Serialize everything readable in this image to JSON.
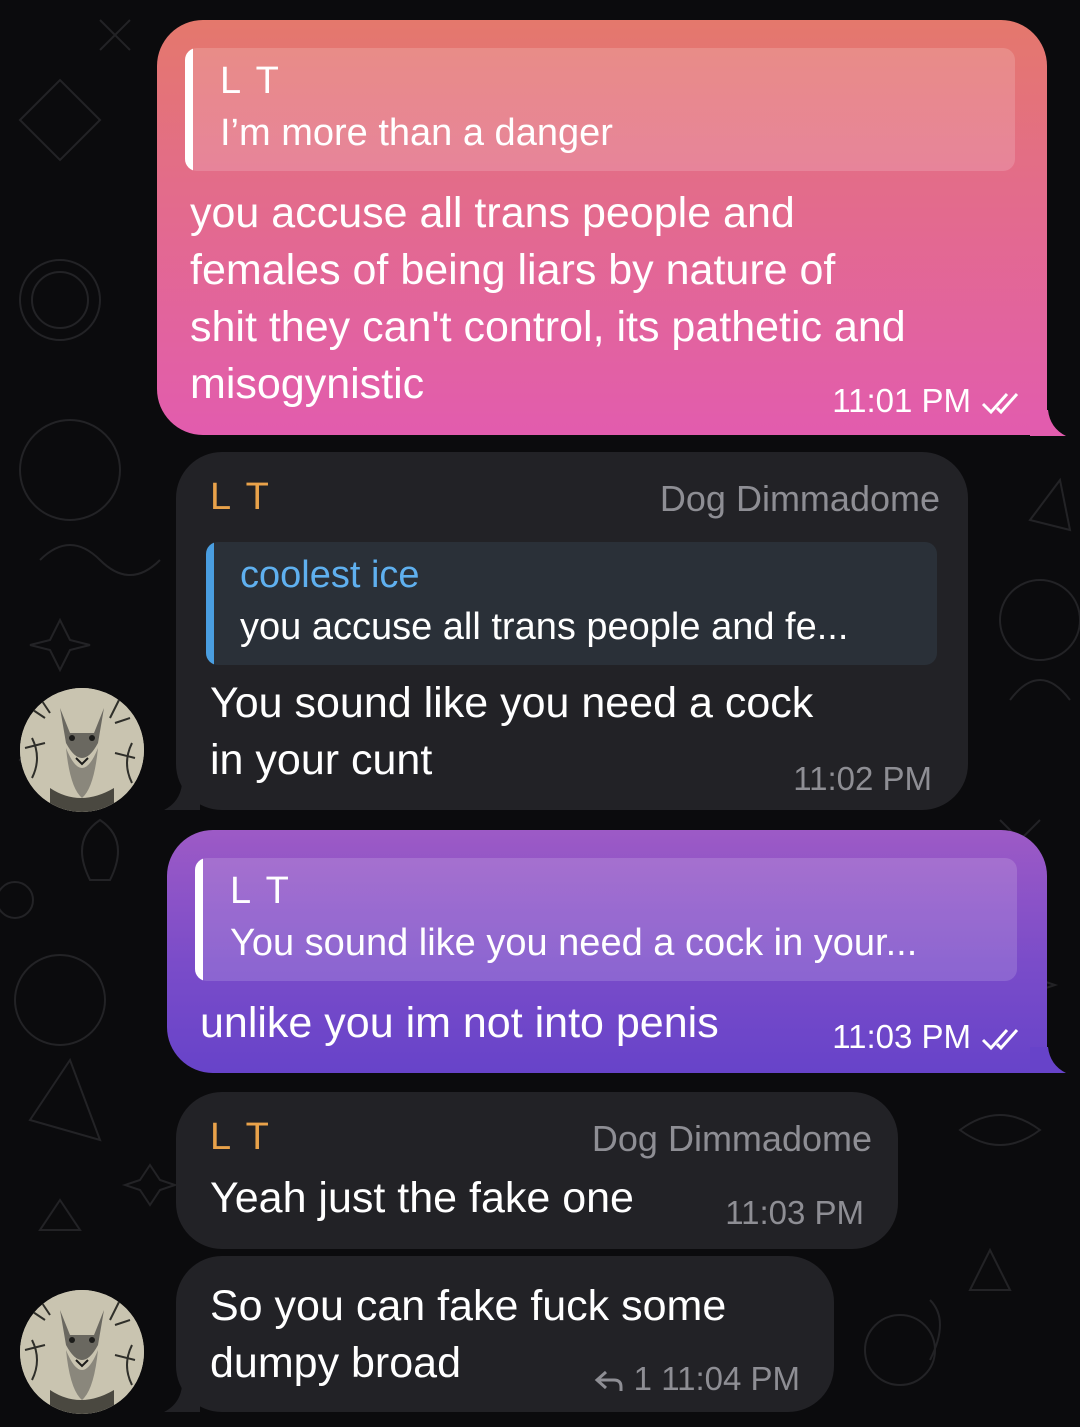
{
  "colors": {
    "outgoing_pink_top": "#e4786c",
    "outgoing_pink_bottom": "#e25cae",
    "outgoing_purple_top": "#9d5ac6",
    "outgoing_purple_bottom": "#6743c9",
    "incoming_bg": "#222226",
    "sender_name": "#e9a24a",
    "reply_name": "#5fb0ef",
    "muted": "#8e8e94"
  },
  "messages": [
    {
      "direction": "outgoing",
      "reply": {
        "name": "L T",
        "text": "I’m more than a danger"
      },
      "lines": [
        "you accuse all trans people and",
        "females of being liars by nature of",
        "shit they can't control, its pathetic and",
        "misogynistic"
      ],
      "time": "11:01 PM",
      "status_icon": "double-check-icon"
    },
    {
      "direction": "incoming",
      "sender": "L T",
      "tag": "Dog Dimmadome",
      "reply": {
        "name": "coolest ice",
        "text": "you accuse all trans people and fe..."
      },
      "lines": [
        "You sound like you need a cock",
        "in your cunt"
      ],
      "time": "11:02 PM",
      "avatar": "wolf-avatar"
    },
    {
      "direction": "outgoing",
      "reply": {
        "name": "L T",
        "text": "You sound like you need a cock in your..."
      },
      "lines": [
        "unlike you im not into penis"
      ],
      "time": "11:03 PM",
      "status_icon": "double-check-icon"
    },
    {
      "direction": "incoming",
      "sender": "L T",
      "tag": "Dog Dimmadome",
      "lines": [
        "Yeah just the fake one"
      ],
      "time": "11:03 PM"
    },
    {
      "direction": "incoming",
      "lines": [
        "So you can fake fuck some",
        "dumpy broad"
      ],
      "reply_count": "1",
      "time": "11:04 PM",
      "avatar": "wolf-avatar"
    }
  ]
}
